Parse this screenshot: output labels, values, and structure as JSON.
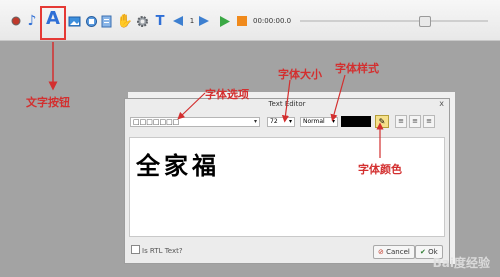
{
  "toolbar": {
    "icons": [
      "record-icon",
      "music-note-icon",
      "text-icon",
      "image-icon",
      "shape-icon",
      "file-icon",
      "hand-icon",
      "gear-icon",
      "text-t-icon",
      "prev-arrow-icon",
      "page-number",
      "next-arrow-icon",
      "play-icon",
      "stop-icon"
    ],
    "page_number": "1",
    "time": "00:00:00.0",
    "slider_position": 0.66,
    "accent_color": "#2f6fd6"
  },
  "dialog": {
    "title": "Text Editor",
    "close": "x",
    "font_value": "□□□□□□□",
    "size_value": "72",
    "style_value": "Normal",
    "color_value": "#000000",
    "content_text": "全家福",
    "rtl_label": "Is RTL Text?",
    "cancel_label": "Cancel",
    "ok_label": "Ok"
  },
  "annotations": {
    "text_button": "文字按钮",
    "font_option": "字体选项",
    "font_size": "字体大小",
    "font_style": "字体样式",
    "font_color": "字体颜色",
    "color": "#d32f2f"
  },
  "watermark": "Bai度经验"
}
